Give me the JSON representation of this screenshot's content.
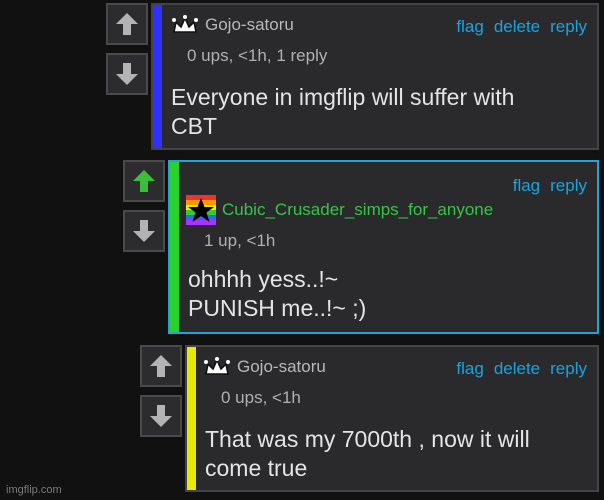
{
  "comments": [
    {
      "username": "Gojo-satoru",
      "meta": "0 ups, <1h, 1 reply",
      "body_line1": "Everyone in imgflip will suffer with",
      "body_line2": "CBT",
      "actions": [
        "flag",
        "delete",
        "reply"
      ],
      "bar_color": "#3131ff",
      "upvoted": false
    },
    {
      "username": "Cubic_Crusader_simps_for_anyone",
      "meta": "1 up, <1h",
      "body_line1": "ohhhh yess..!~",
      "body_line2": "PUNISH me..!~ ;)",
      "actions": [
        "flag",
        "reply"
      ],
      "bar_color": "#2bd12b",
      "upvoted": true
    },
    {
      "username": "Gojo-satoru",
      "meta": "0 ups, <1h",
      "body_line1": "That was my 7000th , now it will",
      "body_line2": "come true",
      "actions": [
        "flag",
        "delete",
        "reply"
      ],
      "bar_color": "#e8e800",
      "upvoted": false
    }
  ],
  "icons": {
    "upvote": "up-arrow-icon",
    "downvote": "down-arrow-icon",
    "badge": "crown-icon"
  },
  "colors": {
    "link": "#1ba3de",
    "upvoted_arrow": "#3bbf3b",
    "highlight_border": "#1fa5d8"
  },
  "watermark": "imgflip.com"
}
